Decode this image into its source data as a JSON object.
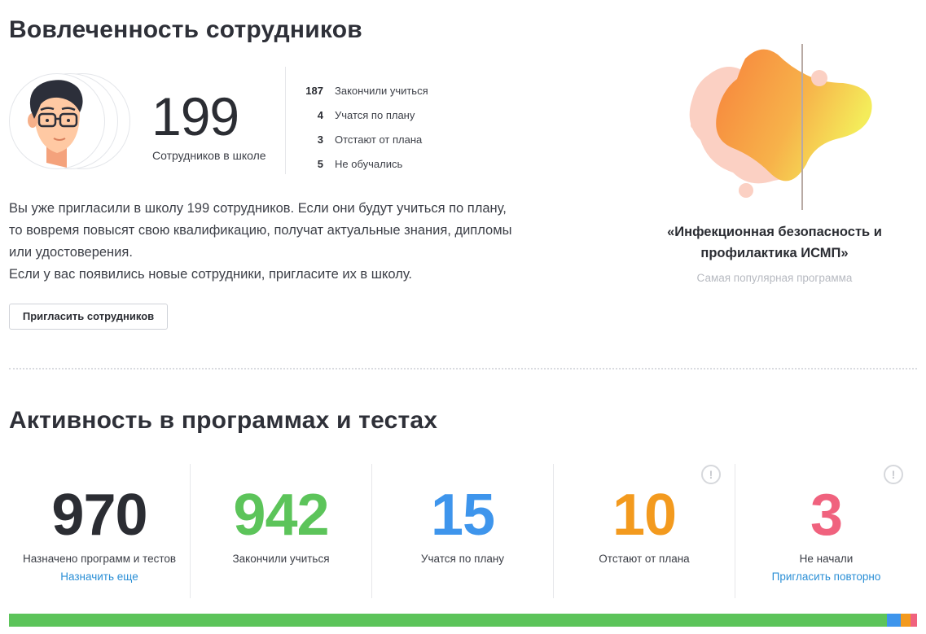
{
  "engagement": {
    "title": "Вовлеченность сотрудников",
    "employees_count": "199",
    "employees_caption": "Сотрудников в школе",
    "stats": [
      {
        "value": "187",
        "label": "Закончили учиться"
      },
      {
        "value": "4",
        "label": "Учатся по плану"
      },
      {
        "value": "3",
        "label": "Отстают от плана"
      },
      {
        "value": "5",
        "label": "Не обучались"
      }
    ],
    "intro_lines": [
      "Вы уже пригласили в школу 199 сотрудников. Если они будут учиться по плану,",
      "то вовремя повысят свою квалификацию, получат актуальные знания, дипломы",
      "или удостоверения.",
      "Если у вас появились новые сотрудники, пригласите их в школу."
    ],
    "invite_button": "Пригласить сотрудников"
  },
  "popular_program": {
    "title_line1": "«Инфекционная безопасность и",
    "title_line2": "профилактика ИСМП»",
    "subtitle": "Самая популярная программа"
  },
  "activity": {
    "title": "Активность в программах и тестах",
    "columns": [
      {
        "value": "970",
        "label": "Назначено программ и тестов",
        "link": "Назначить еще",
        "color": "#2b2d33",
        "alert": false
      },
      {
        "value": "942",
        "label": "Закончили учиться",
        "link": "",
        "color": "#5cc45a",
        "alert": false
      },
      {
        "value": "15",
        "label": "Учатся по плану",
        "link": "",
        "color": "#3e95ec",
        "alert": false
      },
      {
        "value": "10",
        "label": "Отстают от плана",
        "link": "",
        "color": "#f39a1e",
        "alert": true
      },
      {
        "value": "3",
        "label": "Не начали",
        "link": "Пригласить повторно",
        "color": "#f0627e",
        "alert": true
      }
    ],
    "alert_glyph": "!",
    "progress": [
      {
        "name": "completed",
        "value": 942,
        "color": "#5cc45a"
      },
      {
        "name": "on-plan",
        "value": 15,
        "color": "#3e95ec"
      },
      {
        "name": "behind",
        "value": 10,
        "color": "#f39a1e"
      },
      {
        "name": "not-started",
        "value": 3,
        "color": "#f0627e"
      }
    ]
  }
}
